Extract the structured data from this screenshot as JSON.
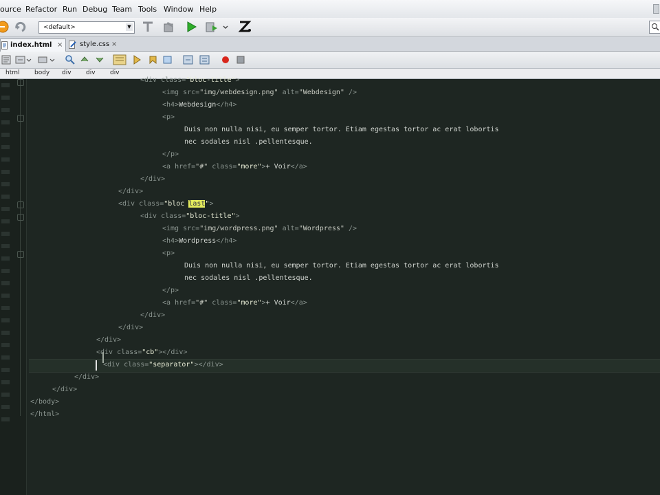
{
  "menu": [
    "ource",
    "Refactor",
    "Run",
    "Debug",
    "Team",
    "Tools",
    "Window",
    "Help"
  ],
  "toolbar": {
    "config_value": "<default>",
    "icons": [
      "undo-icon",
      "redo-icon",
      "clean-icon",
      "build-icon",
      "run-icon",
      "debug-icon",
      "zend-icon",
      "search-icon"
    ]
  },
  "tabs": [
    {
      "label": "index.html",
      "active": true
    },
    {
      "label": "style.css",
      "active": false
    }
  ],
  "breadcrumb": [
    "html",
    "body",
    "div",
    "div",
    "div"
  ],
  "code": {
    "lines": [
      [
        {
          "c": "tg",
          "t": "<div "
        },
        {
          "c": "at",
          "t": "class="
        },
        {
          "c": "st hl",
          "t": "\"bloc-title\""
        },
        {
          "c": "tg",
          "t": ">"
        }
      ],
      [
        {
          "c": "tg",
          "t": "<img "
        },
        {
          "c": "at",
          "t": "src="
        },
        {
          "c": "st",
          "t": "\"img/webdesign.png\""
        },
        {
          "c": "at",
          "t": " alt="
        },
        {
          "c": "st",
          "t": "\"Webdesign\""
        },
        {
          "c": "tg",
          "t": " />"
        }
      ],
      [
        {
          "c": "tg",
          "t": "<h4>"
        },
        {
          "c": "tx",
          "t": "Webdesign"
        },
        {
          "c": "tg",
          "t": "</h4>"
        }
      ],
      [
        {
          "c": "tg",
          "t": "<p>"
        }
      ],
      [
        {
          "c": "tx",
          "t": "Duis non nulla nisi, eu semper tortor. Etiam egestas tortor ac erat lobortis"
        }
      ],
      [
        {
          "c": "tx",
          "t": "nec sodales nisl .pellentesque."
        }
      ],
      [
        {
          "c": "tg",
          "t": "</p>"
        }
      ],
      [
        {
          "c": "tg",
          "t": "<a "
        },
        {
          "c": "at",
          "t": "href="
        },
        {
          "c": "st",
          "t": "\"#\""
        },
        {
          "c": "at",
          "t": " class="
        },
        {
          "c": "st hl",
          "t": "\"more\""
        },
        {
          "c": "tg",
          "t": ">"
        },
        {
          "c": "tx",
          "t": "+ Voir"
        },
        {
          "c": "tg",
          "t": "</a>"
        }
      ],
      [
        {
          "c": "tg",
          "t": "</div>"
        }
      ],
      [
        {
          "c": "tg",
          "t": "</div>"
        }
      ],
      [
        {
          "c": "tg",
          "t": "<div "
        },
        {
          "c": "at",
          "t": "class="
        },
        {
          "c": "st hl",
          "t": "\"bloc "
        },
        {
          "c": "hlword",
          "t": "last"
        },
        {
          "c": "st hl",
          "t": "\""
        },
        {
          "c": "tg",
          "t": ">"
        }
      ],
      [
        {
          "c": "tg",
          "t": "<div "
        },
        {
          "c": "at",
          "t": "class="
        },
        {
          "c": "st hl",
          "t": "\"bloc-title\""
        },
        {
          "c": "tg",
          "t": ">"
        }
      ],
      [
        {
          "c": "tg",
          "t": "<img "
        },
        {
          "c": "at",
          "t": "src="
        },
        {
          "c": "st",
          "t": "\"img/wordpress.png\""
        },
        {
          "c": "at",
          "t": " alt="
        },
        {
          "c": "st",
          "t": "\"Wordpress\""
        },
        {
          "c": "tg",
          "t": " />"
        }
      ],
      [
        {
          "c": "tg",
          "t": "<h4>"
        },
        {
          "c": "tx",
          "t": "Wordpress"
        },
        {
          "c": "tg",
          "t": "</h4>"
        }
      ],
      [
        {
          "c": "tg",
          "t": "<p>"
        }
      ],
      [
        {
          "c": "tx",
          "t": "Duis non nulla nisi, eu semper tortor. Etiam egestas tortor ac erat lobortis"
        }
      ],
      [
        {
          "c": "tx",
          "t": "nec sodales nisl .pellentesque."
        }
      ],
      [
        {
          "c": "tg",
          "t": "</p>"
        }
      ],
      [
        {
          "c": "tg",
          "t": "<a "
        },
        {
          "c": "at",
          "t": "href="
        },
        {
          "c": "st",
          "t": "\"#\""
        },
        {
          "c": "at",
          "t": " class="
        },
        {
          "c": "st hl",
          "t": "\"more\""
        },
        {
          "c": "tg",
          "t": ">"
        },
        {
          "c": "tx",
          "t": "+ Voir"
        },
        {
          "c": "tg",
          "t": "</a>"
        }
      ],
      [
        {
          "c": "tg",
          "t": "</div>"
        }
      ],
      [
        {
          "c": "tg",
          "t": "</div>"
        }
      ],
      [
        {
          "c": "tg",
          "t": "</div>"
        }
      ],
      [
        {
          "c": "tg",
          "t": "<div "
        },
        {
          "c": "at",
          "t": "class="
        },
        {
          "c": "st hl",
          "t": "\"cb\""
        },
        {
          "c": "tg",
          "t": "></div>"
        }
      ],
      [
        {
          "c": "tg",
          "t": "<div "
        },
        {
          "c": "at",
          "t": "class="
        },
        {
          "c": "st hl",
          "t": "\"separator\""
        },
        {
          "c": "tg",
          "t": "></div>"
        }
      ],
      [
        {
          "c": "tg",
          "t": "</div>"
        }
      ],
      [
        {
          "c": "tg",
          "t": "</div>"
        }
      ],
      [
        {
          "c": "tg",
          "t": "</body>"
        }
      ],
      [
        {
          "c": "tg",
          "t": "</html>"
        }
      ]
    ]
  }
}
